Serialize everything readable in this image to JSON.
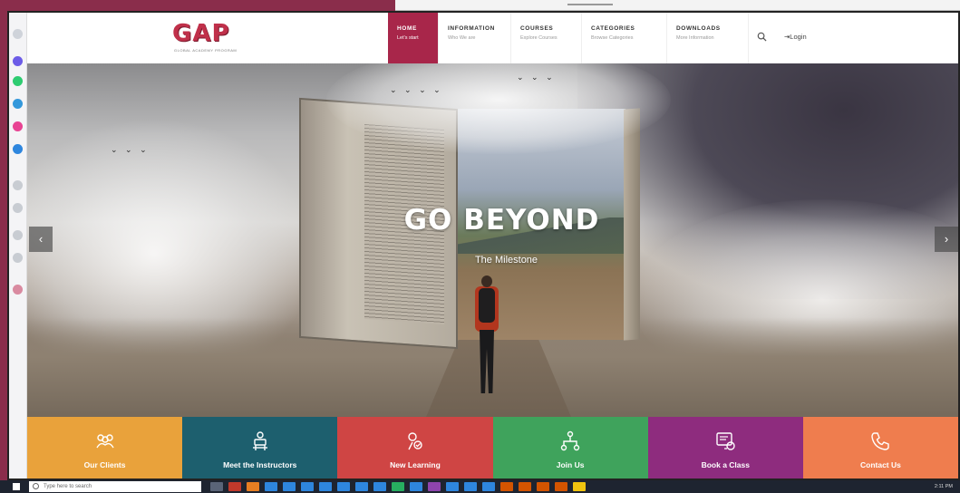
{
  "site": {
    "logo": "GAP",
    "logo_tagline": "GLOBAL ACADEMY PROGRAM"
  },
  "nav": [
    {
      "title": "HOME",
      "subtitle": "Let's start"
    },
    {
      "title": "INFORMATION",
      "subtitle": "Who We are"
    },
    {
      "title": "COURSES",
      "subtitle": "Explore Courses"
    },
    {
      "title": "CATEGORIES",
      "subtitle": "Browse Categories"
    },
    {
      "title": "DOWNLOADS",
      "subtitle": "More Information"
    }
  ],
  "header": {
    "login_label": "Login",
    "search_icon": "search-icon",
    "login_icon": "login-arrow-icon"
  },
  "hero": {
    "title": "GO BEYOND",
    "subtitle": "The Milestone",
    "prev_icon": "chevron-left-icon",
    "next_icon": "chevron-right-icon"
  },
  "features": [
    {
      "label": "Our Clients",
      "icon": "users-icon",
      "color": "#e9a23b"
    },
    {
      "label": "Meet the Instructors",
      "icon": "instructor-icon",
      "color": "#1d5f6e"
    },
    {
      "label": "New Learning",
      "icon": "learning-icon",
      "color": "#cf4544"
    },
    {
      "label": "Join Us",
      "icon": "network-icon",
      "color": "#3fa35c"
    },
    {
      "label": "Book a Class",
      "icon": "book-class-icon",
      "color": "#8e2c7e"
    },
    {
      "label": "Contact Us",
      "icon": "phone-icon",
      "color": "#ef7d4e"
    }
  ],
  "taskbar": {
    "search_placeholder": "Type here to search",
    "clock": "2:11 PM"
  },
  "colors": {
    "brand": "#c0304a",
    "nav_active": "#a8264a",
    "page_border": "#8a2d4b"
  }
}
